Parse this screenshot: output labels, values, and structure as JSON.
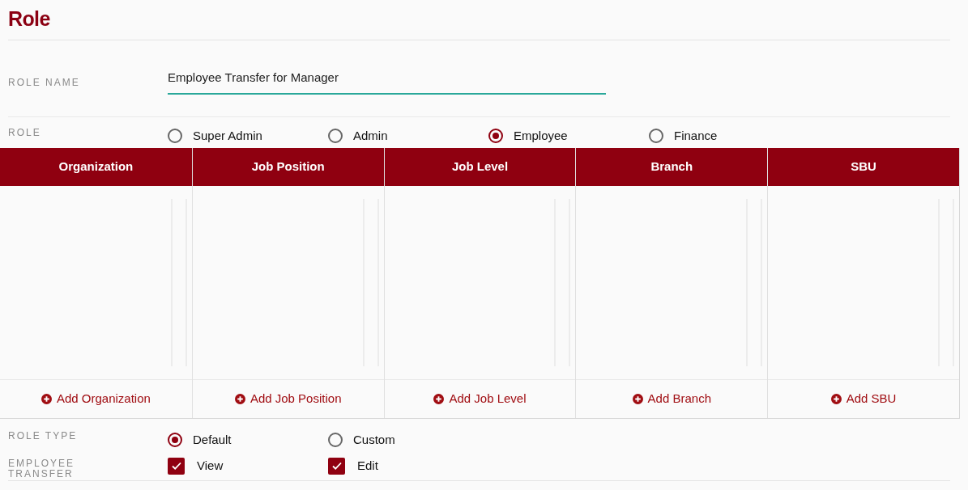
{
  "title": "Role",
  "role_name": {
    "label": "ROLE NAME",
    "value": "Employee Transfer for Manager"
  },
  "role": {
    "label": "ROLE",
    "options": [
      {
        "label": "Super Admin",
        "selected": false
      },
      {
        "label": "Admin",
        "selected": false
      },
      {
        "label": "Employee",
        "selected": true
      },
      {
        "label": "Finance",
        "selected": false
      }
    ]
  },
  "table": {
    "columns": [
      {
        "heading": "Organization",
        "add": "Add Organization"
      },
      {
        "heading": "Job Position",
        "add": "Add Job Position"
      },
      {
        "heading": "Job Level",
        "add": "Add Job Level"
      },
      {
        "heading": "Branch",
        "add": "Add Branch"
      },
      {
        "heading": "SBU",
        "add": "Add SBU"
      }
    ]
  },
  "role_type": {
    "label": "ROLE TYPE",
    "options": [
      {
        "label": "Default",
        "selected": true
      },
      {
        "label": "Custom",
        "selected": false
      }
    ]
  },
  "employee_transfer": {
    "label": "EMPLOYEE TRANSFER",
    "options": [
      {
        "label": "View",
        "checked": true
      },
      {
        "label": "Edit",
        "checked": true
      }
    ]
  }
}
